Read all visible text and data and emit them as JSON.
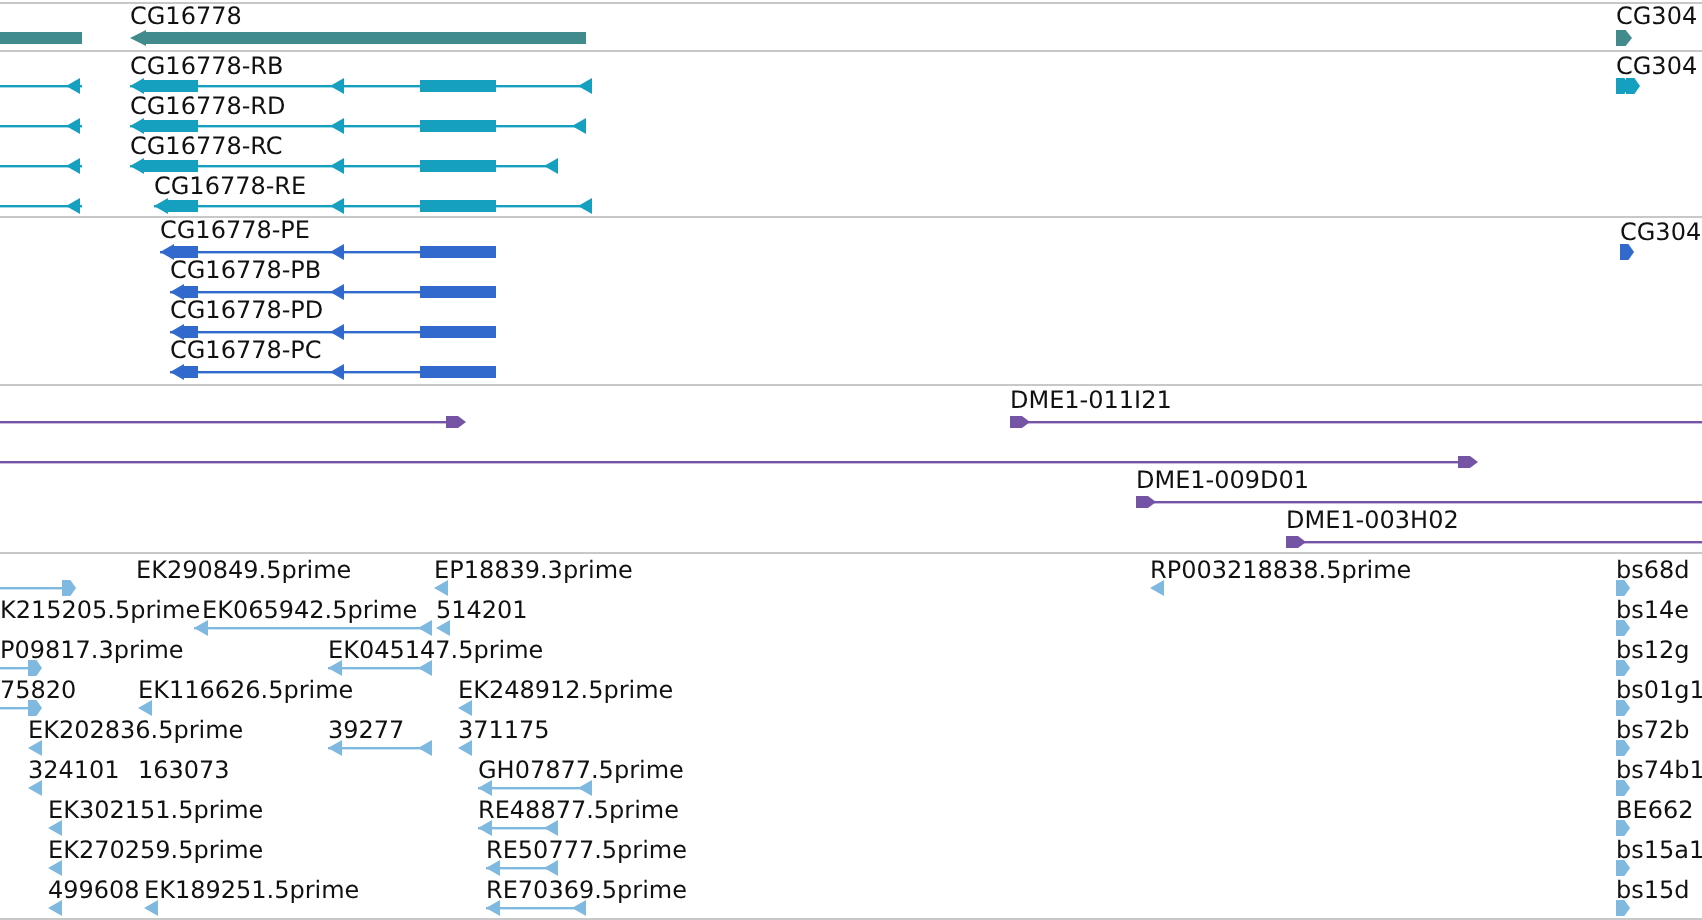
{
  "tracks": [
    {
      "kind": "gene",
      "features": [
        {
          "label": "CG16778",
          "reverse_strand": true
        },
        {
          "label": "CG304",
          "reverse_strand": false
        }
      ]
    },
    {
      "kind": "transcript",
      "features": [
        {
          "reverse_strand": true
        },
        {
          "label": "CG16778-RB",
          "reverse_strand": true
        },
        {
          "reverse_strand": true
        },
        {
          "label": "CG16778-RD",
          "reverse_strand": true
        },
        {
          "reverse_strand": true
        },
        {
          "label": "CG16778-RC",
          "reverse_strand": true
        },
        {
          "reverse_strand": true
        },
        {
          "label": "CG16778-RE",
          "reverse_strand": true
        },
        {
          "label": "CG304",
          "reverse_strand": false
        }
      ]
    },
    {
      "kind": "protein",
      "features": [
        {
          "label": "CG16778-PE",
          "reverse_strand": true
        },
        {
          "label": "CG16778-PB",
          "reverse_strand": true
        },
        {
          "label": "CG16778-PD",
          "reverse_strand": true
        },
        {
          "label": "CG16778-PC",
          "reverse_strand": true
        },
        {
          "label": "CG304",
          "reverse_strand": false
        }
      ]
    },
    {
      "kind": "clone",
      "features": [
        {
          "reverse_strand": false
        },
        {
          "label": "DME1-011I21",
          "reverse_strand": false
        },
        {
          "reverse_strand": false
        },
        {
          "label": "DME1-009D01",
          "reverse_strand": false
        },
        {
          "label": "DME1-003H02",
          "reverse_strand": false
        }
      ]
    },
    {
      "kind": "est",
      "features": [
        {
          "reverse_strand": false
        },
        {
          "label": "EK290849.5prime"
        },
        {
          "label": "EP18839.3prime",
          "reverse_strand": true
        },
        {
          "label": "RP003218838.5prime",
          "reverse_strand": true
        },
        {
          "label": "bs68d",
          "reverse_strand": false
        },
        {
          "label": "K215205.5prime"
        },
        {
          "label": "EK065942.5prime",
          "reverse_strand": true
        },
        {
          "label": "514201",
          "reverse_strand": true
        },
        {
          "label": "bs14e",
          "reverse_strand": false
        },
        {
          "label": "P09817.3prime",
          "reverse_strand": false
        },
        {
          "label": "EK045147.5prime",
          "reverse_strand": true
        },
        {
          "label": "bs12g",
          "reverse_strand": false
        },
        {
          "label": "75820",
          "reverse_strand": false
        },
        {
          "label": "EK116626.5prime",
          "reverse_strand": true
        },
        {
          "label": "EK248912.5prime",
          "reverse_strand": true
        },
        {
          "label": "bs01g1",
          "reverse_strand": false
        },
        {
          "label": "EK202836.5prime",
          "reverse_strand": true
        },
        {
          "label": "39277",
          "reverse_strand": true
        },
        {
          "label": "371175",
          "reverse_strand": true
        },
        {
          "label": "bs72b",
          "reverse_strand": false
        },
        {
          "label": "324101",
          "reverse_strand": true
        },
        {
          "label": "163073"
        },
        {
          "label": "GH07877.5prime",
          "reverse_strand": true
        },
        {
          "label": "bs74b1",
          "reverse_strand": false
        },
        {
          "label": "EK302151.5prime",
          "reverse_strand": true
        },
        {
          "label": "RE48877.5prime",
          "reverse_strand": true
        },
        {
          "label": "BE662",
          "reverse_strand": false
        },
        {
          "label": "EK270259.5prime",
          "reverse_strand": true
        },
        {
          "label": "RE50777.5prime",
          "reverse_strand": true
        },
        {
          "label": "bs15a1",
          "reverse_strand": false
        },
        {
          "label": "499608",
          "reverse_strand": true
        },
        {
          "label": "EK189251.5prime",
          "reverse_strand": true
        },
        {
          "label": "RE70369.5prime",
          "reverse_strand": true
        },
        {
          "label": "bs15d",
          "reverse_strand": false
        }
      ]
    }
  ]
}
